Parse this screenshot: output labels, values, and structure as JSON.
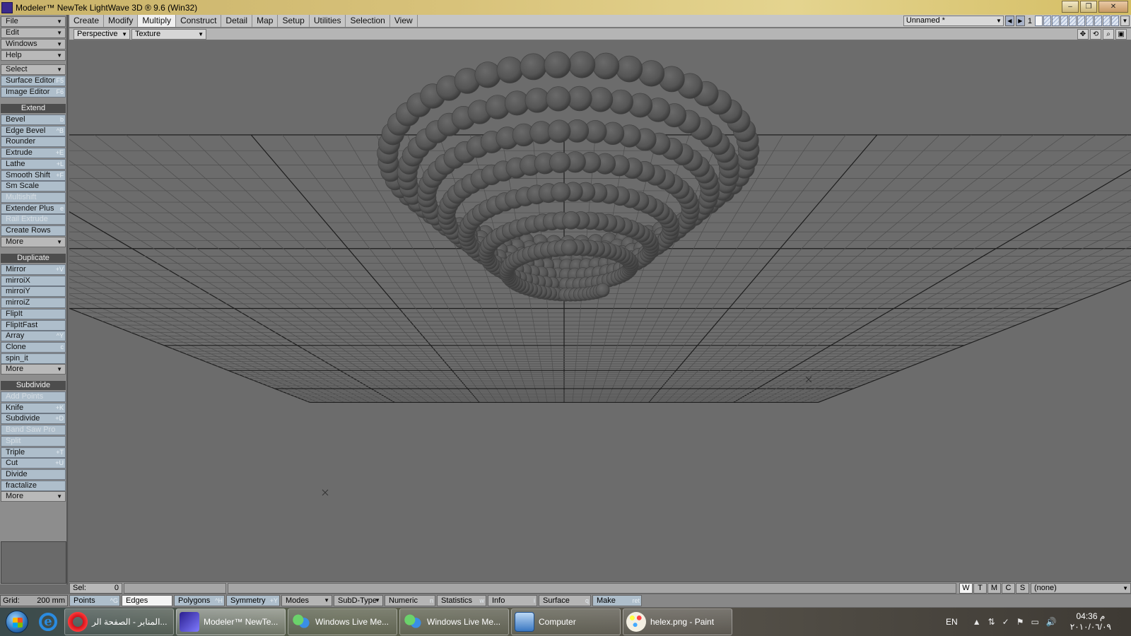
{
  "window": {
    "title": "Modeler™ NewTek LightWave 3D ® 9.6  (Win32)",
    "minimize_glyph": "–",
    "restore_glyph": "❐",
    "close_glyph": "✕"
  },
  "tabs": [
    "Create",
    "Modify",
    "Multiply",
    "Construct",
    "Detail",
    "Map",
    "Setup",
    "Utilities",
    "Selection",
    "View"
  ],
  "active_tab": "Multiply",
  "object_selector": {
    "value": "Unnamed *",
    "layer_number": "1",
    "nav_prev": "◀",
    "nav_next": "▶"
  },
  "viewport": {
    "view_mode": "Perspective",
    "render_mode": "Texture"
  },
  "left_menu": {
    "file": "File",
    "edit": "Edit",
    "windows": "Windows",
    "help": "Help",
    "select": "Select",
    "surface_editor": {
      "label": "Surface Editor",
      "shortcut": "F5"
    },
    "image_editor": {
      "label": "Image Editor",
      "shortcut": "F6"
    }
  },
  "extend": {
    "header": "Extend",
    "items": [
      {
        "label": "Bevel",
        "shortcut": "b"
      },
      {
        "label": "Edge Bevel",
        "shortcut": "^B"
      },
      {
        "label": "Rounder",
        "shortcut": ""
      },
      {
        "label": "Extrude",
        "shortcut": "+E"
      },
      {
        "label": "Lathe",
        "shortcut": "+L"
      },
      {
        "label": "Smooth Shift",
        "shortcut": "+F"
      },
      {
        "label": "Sm Scale",
        "shortcut": ""
      },
      {
        "label": "Multishift",
        "shortcut": ""
      },
      {
        "label": "Extender Plus",
        "shortcut": "e"
      },
      {
        "label": "Rail Extrude",
        "shortcut": ""
      },
      {
        "label": "Create Rows",
        "shortcut": ""
      }
    ],
    "more": "More"
  },
  "duplicate": {
    "header": "Duplicate",
    "items": [
      {
        "label": "Mirror",
        "shortcut": "+V"
      },
      {
        "label": "mirroiX",
        "shortcut": ""
      },
      {
        "label": "mirroiY",
        "shortcut": ""
      },
      {
        "label": "mirroiZ",
        "shortcut": ""
      },
      {
        "label": "FlipIt",
        "shortcut": ""
      },
      {
        "label": "FlipItFast",
        "shortcut": ""
      },
      {
        "label": "Array",
        "shortcut": "^Y"
      },
      {
        "label": "Clone",
        "shortcut": "c"
      },
      {
        "label": "spin_it",
        "shortcut": ""
      }
    ],
    "more": "More"
  },
  "subdivide": {
    "header": "Subdivide",
    "items": [
      {
        "label": "Add Points",
        "shortcut": ""
      },
      {
        "label": "Knife",
        "shortcut": "+K"
      },
      {
        "label": "Subdivide",
        "shortcut": "+D"
      },
      {
        "label": "Band Saw Pro",
        "shortcut": ""
      },
      {
        "label": "Split",
        "shortcut": ""
      },
      {
        "label": "Triple",
        "shortcut": "+T"
      },
      {
        "label": "Cut",
        "shortcut": "+U"
      },
      {
        "label": "Divide",
        "shortcut": ""
      },
      {
        "label": "fractalize",
        "shortcut": ""
      }
    ],
    "more": "More"
  },
  "status": {
    "sel_label": "Sel:",
    "sel_value": "0",
    "view_buttons": [
      "W",
      "T",
      "M",
      "C",
      "S"
    ],
    "active_view_button": "W",
    "surface_dropdown": "(none)"
  },
  "modebar": {
    "grid_label": "Grid:",
    "grid_value": "200 mm",
    "points": {
      "label": "Points",
      "shortcut": "^G"
    },
    "edges": {
      "label": "Edges",
      "shortcut": ""
    },
    "polygons": {
      "label": "Polygons",
      "shortcut": "^H"
    },
    "symmetry": {
      "label": "Symmetry",
      "shortcut": "+Y"
    },
    "modes": "Modes",
    "subd_type": "SubD-Type",
    "numeric": {
      "label": "Numeric",
      "shortcut": "n"
    },
    "statistics": {
      "label": "Statistics",
      "shortcut": "w"
    },
    "info": {
      "label": "Info",
      "shortcut": "i"
    },
    "surface": {
      "label": "Surface",
      "shortcut": "q"
    },
    "make": {
      "label": "Make",
      "shortcut": "ret"
    }
  },
  "taskbar": {
    "ie_glyph": "e",
    "tasks": [
      {
        "label": "المنابر - الصفحة الر...",
        "icon": "opera-icon"
      },
      {
        "label": "Modeler™ NewTe...",
        "icon": "lightwave-icon"
      },
      {
        "label": "Windows Live Me...",
        "icon": "msn-icon"
      },
      {
        "label": "Windows Live Me...",
        "icon": "msn-icon"
      },
      {
        "label": "Computer",
        "icon": "computer-icon"
      },
      {
        "label": "helex.png - Paint",
        "icon": "paint-icon"
      }
    ],
    "tray": {
      "language": "EN",
      "arrow": "▲",
      "network": "⇅",
      "antivirus": "✓",
      "flag": "⚑",
      "monitor": "▭",
      "volume": "🔊"
    },
    "clock": {
      "time": "04:36 م",
      "date": "٢٠١٠/٠٦/٠٩"
    }
  },
  "colors": {
    "viewport_bg": "#6c6c6c",
    "grid_line": "#4e4e4e",
    "grid_major": "#1e1e1e",
    "sphere": "#555555",
    "button_blue": "#aebecb"
  }
}
